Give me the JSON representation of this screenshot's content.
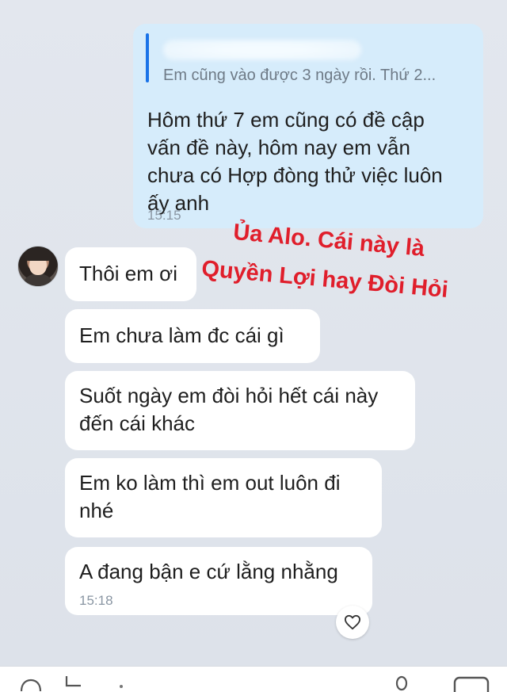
{
  "outgoing": {
    "quote_text": "Em cũng vào được 3 ngày rồi. Thứ 2...",
    "text": "Hôm thứ 7 em cũng có đề cập\nvấn đề này, hôm nay em vẫn\nchưa có Hợp đòng thử việc luôn\nấy anh",
    "time": "15:15"
  },
  "incoming": [
    {
      "text": "Thôi em ơi"
    },
    {
      "text": "Em chưa làm đc cái gì"
    },
    {
      "text": "Suốt ngày em đòi hỏi hết cái này\nđến cái khác"
    },
    {
      "text": "Em ko làm thì em out luôn đi\nnhé"
    },
    {
      "text": "A đang bận e cứ lằng nhằng",
      "time": "15:18"
    }
  ],
  "annotation": {
    "line1": "Ủa Alo. Cái này là",
    "line2": "Quyền Lợi hay Đòi Hỏi"
  },
  "colors": {
    "outgoing_bubble": "#d6ecfb",
    "incoming_bubble": "#ffffff",
    "annotation": "#e01e2b",
    "quote_bar": "#1a73e8"
  },
  "icons": {
    "reaction": "heart-icon",
    "bottom_left": "emoji-icon",
    "bottom_left_2": "attachment-icon",
    "bottom_right": "mic-icon",
    "bottom_right_2": "image-icon"
  }
}
